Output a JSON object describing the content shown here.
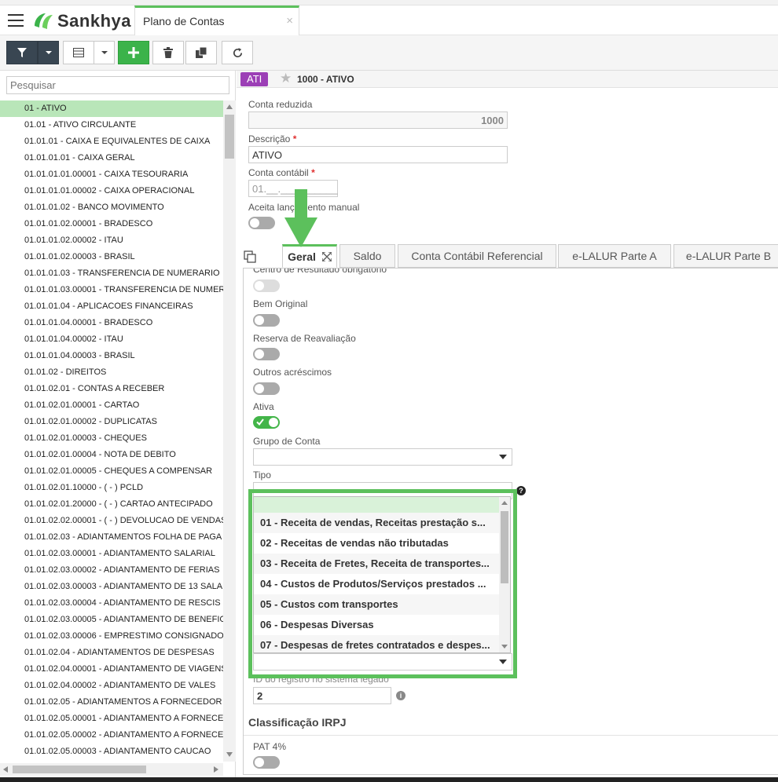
{
  "header": {
    "brand": "Sankhya",
    "tab_title": "Plano de Contas",
    "tab_close": "×"
  },
  "search": {
    "placeholder": "Pesquisar"
  },
  "tree": {
    "items": [
      "01 - ATIVO",
      "01.01 - ATIVO CIRCULANTE",
      "01.01.01 - CAIXA E EQUIVALENTES DE CAIXA",
      "01.01.01.01 - CAIXA GERAL",
      "01.01.01.01.00001 - CAIXA TESOURARIA",
      "01.01.01.01.00002 - CAIXA OPERACIONAL",
      "01.01.01.02 - BANCO MOVIMENTO",
      "01.01.01.02.00001 - BRADESCO",
      "01.01.01.02.00002 - ITAU",
      "01.01.01.02.00003 - BRASIL",
      "01.01.01.03 - TRANSFERENCIA DE NUMERARIO",
      "01.01.01.03.00001 - TRANSFERENCIA DE NUMER",
      "01.01.01.04 - APLICACOES FINANCEIRAS",
      "01.01.01.04.00001 - BRADESCO",
      "01.01.01.04.00002 - ITAU",
      "01.01.01.04.00003 - BRASIL",
      "01.01.02 - DIREITOS",
      "01.01.02.01 - CONTAS A RECEBER",
      "01.01.02.01.00001 - CARTAO",
      "01.01.02.01.00002 - DUPLICATAS",
      "01.01.02.01.00003 - CHEQUES",
      "01.01.02.01.00004 - NOTA DE DEBITO",
      "01.01.02.01.00005 - CHEQUES A COMPENSAR",
      "01.01.02.01.10000 - ( - ) PCLD",
      "01.01.02.01.20000 - ( - ) CARTAO ANTECIPADO",
      "01.01.02.02.00001 - ( - ) DEVOLUCAO DE VENDAS",
      "01.01.02.03 - ADIANTAMENTOS FOLHA DE PAGA",
      "01.01.02.03.00001 - ADIANTAMENTO SALARIAL",
      "01.01.02.03.00002 - ADIANTAMENTO DE FERIAS",
      "01.01.02.03.00003 - ADIANTAMENTO DE 13 SALA",
      "01.01.02.03.00004 - ADIANTAMENTO DE RESCIS",
      "01.01.02.03.00005 - ADIANTAMENTO DE BENEFIC",
      "01.01.02.03.00006 - EMPRESTIMO CONSIGNADO",
      "01.01.02.04 - ADIANTAMENTOS DE DESPESAS",
      "01.01.02.04.00001 - ADIANTAMENTO DE VIAGENS",
      "01.01.02.04.00002 - ADIANTAMENTO DE VALES",
      "01.01.02.05 - ADIANTAMENTOS A FORNECEDOR",
      "01.01.02.05.00001 - ADIANTAMENTO A FORNECE",
      "01.01.02.05.00002 - ADIANTAMENTO A FORNECE",
      "01.01.02.05.00003 - ADIANTAMENTO CAUCAO"
    ]
  },
  "record": {
    "badge": "ATI",
    "title": "1000 - ATIVO"
  },
  "form": {
    "conta_reduzida_label": "Conta reduzida",
    "conta_reduzida_value": "1000",
    "descricao_label": "Descrição",
    "descricao_value": "ATIVO",
    "conta_contabil_label": "Conta contábil",
    "conta_contabil_value": "01.__.__________",
    "aceita_label": "Aceita lançamento manual",
    "required_mark": "*"
  },
  "tabs": [
    "Geral",
    "Saldo",
    "Conta Contábil Referencial",
    "e-LALUR Parte A",
    "e-LALUR Parte B"
  ],
  "geral": {
    "centro_label": "Centro de Resultado obrigatório",
    "bem_label": "Bem Original",
    "reserva_label": "Reserva de Reavaliação",
    "outros_label": "Outros acréscimos",
    "ativa_label": "Ativa",
    "ativa_state": "on",
    "grupo_label": "Grupo de Conta",
    "tipo_label": "Tipo",
    "id_label": "ID do registro no sistema legado",
    "id_value": "2",
    "irpj_heading": "Classificação IRPJ",
    "pat_label": "PAT 4%"
  },
  "tipo_options": [
    "01 - Receita de vendas, Receitas prestação s...",
    "02 - Receitas de vendas não tributadas",
    "03 - Receita de Fretes, Receita de transportes...",
    "04 - Custos de Produtos/Serviços prestados ...",
    "05 - Custos com transportes",
    "06 - Despesas Diversas",
    "07 - Despesas de fretes contratados e despes..."
  ],
  "colors": {
    "accent": "#5cc05c",
    "badge": "#9c3fb6",
    "selected_row": "#b9e6b9",
    "add_button": "#3bb34a"
  }
}
